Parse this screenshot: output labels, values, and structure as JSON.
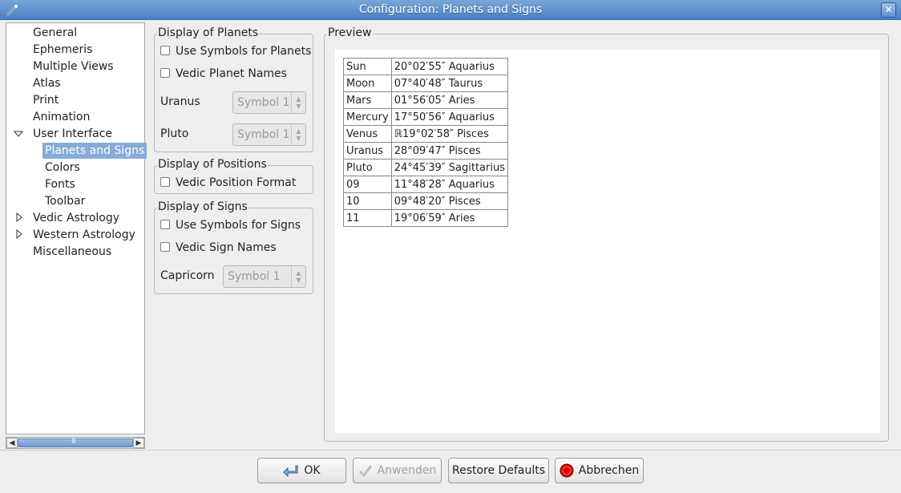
{
  "window": {
    "title": "Configuration: Planets and Signs",
    "close_glyph": "✕"
  },
  "sidebar": {
    "items": [
      {
        "label": "General"
      },
      {
        "label": "Ephemeris"
      },
      {
        "label": "Multiple Views"
      },
      {
        "label": "Atlas"
      },
      {
        "label": "Print"
      },
      {
        "label": "Animation"
      },
      {
        "label": "User Interface",
        "expanded": true
      },
      {
        "label": "Planets and Signs",
        "selected": true
      },
      {
        "label": "Colors"
      },
      {
        "label": "Fonts"
      },
      {
        "label": "Toolbar"
      },
      {
        "label": "Vedic Astrology",
        "expanded": false
      },
      {
        "label": "Western Astrology",
        "expanded": false
      },
      {
        "label": "Miscellaneous"
      }
    ],
    "scroll_grip": "III"
  },
  "planets": {
    "title": "Display of Planets",
    "use_symbols": "Use Symbols for Planets",
    "vedic_names": "Vedic Planet Names",
    "uranus_label": "Uranus",
    "uranus_value": "Symbol 1",
    "pluto_label": "Pluto",
    "pluto_value": "Symbol 1"
  },
  "positions": {
    "title": "Display of Positions",
    "vedic_format": "Vedic Position Format"
  },
  "signs": {
    "title": "Display of Signs",
    "use_symbols": "Use Symbols for Signs",
    "vedic_names": "Vedic Sign Names",
    "capricorn_label": "Capricorn",
    "capricorn_value": "Symbol 1"
  },
  "preview": {
    "title": "Preview",
    "rows": [
      {
        "name": "Sun",
        "pos": "20°02′55″ Aquarius"
      },
      {
        "name": "Moon",
        "pos": "07°40′48″ Taurus"
      },
      {
        "name": "Mars",
        "pos": "01°56′05″ Aries"
      },
      {
        "name": "Mercury",
        "pos": "17°50′56″ Aquarius"
      },
      {
        "name": "Venus",
        "pos": "ℝ19°02′58″ Pisces"
      },
      {
        "name": "Uranus",
        "pos": "28°09′47″ Pisces"
      },
      {
        "name": "Pluto",
        "pos": "24°45′39″ Sagittarius"
      },
      {
        "name": "09",
        "pos": "11°48′28″ Aquarius"
      },
      {
        "name": "10",
        "pos": "09°48′20″ Pisces"
      },
      {
        "name": "11",
        "pos": "19°06′59″ Aries"
      }
    ]
  },
  "buttons": {
    "ok": "OK",
    "apply": "Anwenden",
    "restore": "Restore Defaults",
    "cancel": "Abbrechen"
  },
  "colors": {
    "titlebar": "#4a7fc1",
    "selection": "#86abd9",
    "cancel_icon": "#d40000"
  }
}
